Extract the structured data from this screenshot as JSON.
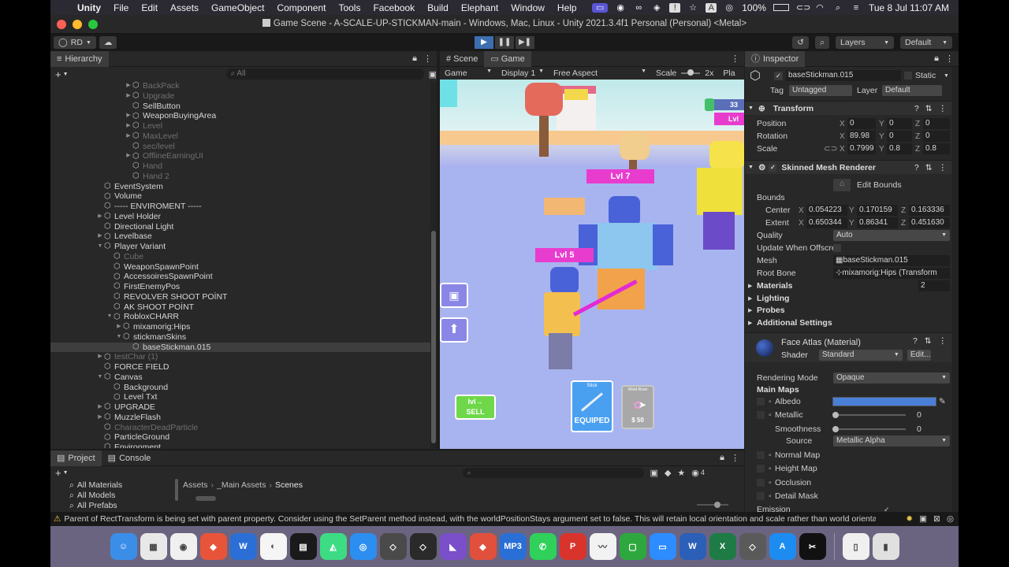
{
  "menubar": {
    "app": "Unity",
    "items": [
      "File",
      "Edit",
      "Assets",
      "GameObject",
      "Component",
      "Tools",
      "Facebook",
      "Build",
      "Elephant",
      "Window",
      "Help"
    ],
    "battery": "100%",
    "datetime": "Tue 8 Jul  11:07 AM"
  },
  "window": {
    "title": "Game Scene - A-SCALE-UP-STICKMAN-main - Windows, Mac, Linux - Unity 2021.3.4f1 Personal (Personal) <Metal>"
  },
  "toolbar": {
    "account": "RD",
    "layers": "Layers",
    "layout": "Default"
  },
  "hierarchy": {
    "tab": "Hierarchy",
    "search_placeholder": "All",
    "rows": [
      {
        "label": "BackPack",
        "dim": true
      },
      {
        "label": "Upgrade",
        "dim": true
      },
      {
        "label": "SellButton",
        "dim": false
      },
      {
        "label": "WeaponBuyingArea",
        "dim": false
      },
      {
        "label": "Level",
        "dim": true
      },
      {
        "label": "MaxLevel",
        "dim": true
      },
      {
        "label": "sec/level",
        "dim": true
      },
      {
        "label": "OfflineEarningUI",
        "dim": true
      },
      {
        "label": "Hand",
        "dim": true
      },
      {
        "label": "Hand 2",
        "dim": true
      },
      {
        "label": "EventSystem",
        "dim": false
      },
      {
        "label": "Volume",
        "dim": false
      },
      {
        "label": "----- ENVIROMENT -----",
        "dim": false
      },
      {
        "label": "Level Holder",
        "dim": false
      },
      {
        "label": "Directional Light",
        "dim": false
      },
      {
        "label": "Levelbase",
        "dim": false
      },
      {
        "label": "Player Variant",
        "dim": false
      },
      {
        "label": "Cube",
        "dim": true
      },
      {
        "label": "WeaponSpawnPoint",
        "dim": false
      },
      {
        "label": "AccessoiresSpawnPoint",
        "dim": false
      },
      {
        "label": "FirstEnemyPos",
        "dim": false
      },
      {
        "label": "REVOLVER SHOOT POİNT",
        "dim": false
      },
      {
        "label": "AK SHOOT POİNT",
        "dim": false
      },
      {
        "label": "RobloxCHARR",
        "dim": false
      },
      {
        "label": "mixamorig:Hips",
        "dim": false
      },
      {
        "label": "stickmanSkins",
        "dim": false
      },
      {
        "label": "baseStickman.015",
        "dim": false
      },
      {
        "label": "testChar (1)",
        "dim": true
      },
      {
        "label": "FORCE FIELD",
        "dim": false
      },
      {
        "label": "Canvas",
        "dim": false
      },
      {
        "label": "Background",
        "dim": false
      },
      {
        "label": "Level Txt",
        "dim": false
      },
      {
        "label": "UPGRADE",
        "dim": false
      },
      {
        "label": "MuzzleFlash",
        "dim": false
      },
      {
        "label": "CharacterDeadParticle",
        "dim": true
      },
      {
        "label": "ParticleGround",
        "dim": false
      },
      {
        "label": "Environment",
        "dim": false
      }
    ]
  },
  "game": {
    "tabs": [
      "Scene",
      "Game"
    ],
    "mode": "Game",
    "display": "Display 1",
    "aspect": "Free Aspect",
    "scale_label": "Scale",
    "scale_value": "2x",
    "play_label": "Pla",
    "hud": {
      "coins": "33",
      "enemy_far_level": "Lvl",
      "enemy_level": "Lvl 7",
      "player_level": "Lvl 5",
      "sell_line": "lvl→",
      "sell_label": "SELL",
      "weapon1_name": "Stick",
      "weapon1_status": "EQUIPED",
      "weapon2_name": "Wind Rose",
      "weapon2_price": "$ 50"
    }
  },
  "inspector": {
    "tab": "Inspector",
    "object_name": "baseStickman.015",
    "static_label": "Static",
    "tag_label": "Tag",
    "tag_value": "Untagged",
    "layer_label": "Layer",
    "layer_value": "Default",
    "transform": {
      "title": "Transform",
      "position_label": "Position",
      "position": [
        "0",
        "0",
        "0"
      ],
      "rotation_label": "Rotation",
      "rotation": [
        "89.98",
        "0",
        "0"
      ],
      "scale_label": "Scale",
      "scale": [
        "0.7999",
        "0.8",
        "0.8"
      ]
    },
    "smr": {
      "title": "Skinned Mesh Renderer",
      "edit_bounds": "Edit Bounds",
      "bounds_label": "Bounds",
      "center_label": "Center",
      "center": [
        "0.054223",
        "0.170159",
        "0.163336"
      ],
      "extent_label": "Extent",
      "extent": [
        "0.650344",
        "0.86341",
        "0.451630"
      ],
      "quality_label": "Quality",
      "quality_value": "Auto",
      "update_offscreen_label": "Update When Offscre",
      "mesh_label": "Mesh",
      "mesh_value": "baseStickman.015",
      "root_bone_label": "Root Bone",
      "root_bone_value": "mixamorig:Hips (Transform",
      "materials_label": "Materials",
      "materials_count": "2",
      "lighting_label": "Lighting",
      "probes_label": "Probes",
      "additional_label": "Additional Settings"
    },
    "material": {
      "title": "Face Atlas (Material)",
      "shader_label": "Shader",
      "shader_value": "Standard",
      "edit_label": "Edit...",
      "rendering_mode_label": "Rendering Mode",
      "rendering_mode_value": "Opaque",
      "main_maps_label": "Main Maps",
      "albedo_label": "Albedo",
      "albedo_color": "#4a7fd8",
      "metallic_label": "Metallic",
      "metallic_value": "0",
      "smoothness_label": "Smoothness",
      "smoothness_value": "0",
      "source_label": "Source",
      "source_value": "Metallic Alpha",
      "normal_label": "Normal Map",
      "height_label": "Height Map",
      "occlusion_label": "Occlusion",
      "detail_label": "Detail Mask",
      "emission_label": "Emission"
    }
  },
  "project": {
    "tabs": [
      "Project",
      "Console"
    ],
    "favorites": [
      "All Materials",
      "All Models",
      "All Prefabs"
    ],
    "breadcrumb": [
      "Assets",
      "_Main Assets",
      "Scenes"
    ],
    "count": "4"
  },
  "status": {
    "message": "Parent of RectTransform is being set with parent property. Consider using the SetParent method instead, with the worldPositionStays argument set to false. This will retain local orientation and scale rather than world orientation anc"
  },
  "dock": {
    "icons": [
      "finder-icon",
      "launchpad-icon",
      "chrome-icon",
      "git-icon",
      "word-blue-icon",
      "blender-icon",
      "activity-monitor-icon",
      "android-studio-icon",
      "safari-icon",
      "unity-icon",
      "unity-hub-icon",
      "visual-studio-icon",
      "git-client-icon",
      "mp3-icon",
      "whatsapp-icon",
      "powerpoint-icon",
      "freeform-icon",
      "file-icon",
      "zoom-icon",
      "word-icon",
      "excel-icon",
      "unity-alt-icon",
      "app-store-icon",
      "capcut-icon",
      "document-icon",
      "trash-icon"
    ]
  }
}
